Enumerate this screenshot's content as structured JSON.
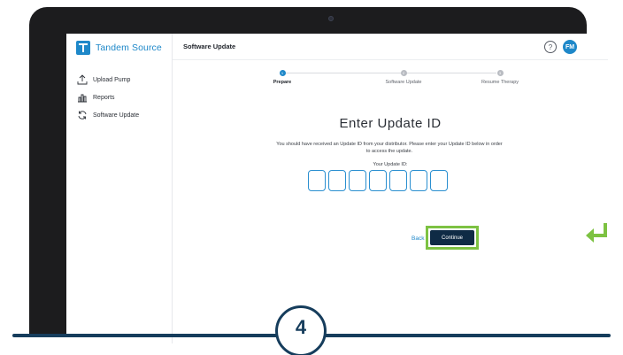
{
  "app": {
    "brand_name": "Tandem Source",
    "brand_color": "#1e88c9"
  },
  "sidebar": {
    "items": [
      {
        "label": "Upload Pump",
        "icon": "upload-icon"
      },
      {
        "label": "Reports",
        "icon": "bar-chart-icon"
      },
      {
        "label": "Software Update",
        "icon": "refresh-icon"
      }
    ]
  },
  "header": {
    "title": "Software Update",
    "help_glyph": "?",
    "avatar_initials": "FM"
  },
  "stepper": {
    "steps": [
      {
        "number": "1",
        "label": "Prepare",
        "active": true
      },
      {
        "number": "2",
        "label": "Software Update",
        "active": false
      },
      {
        "number": "3",
        "label": "Resume Therapy",
        "active": false
      }
    ]
  },
  "main": {
    "heading": "Enter Update ID",
    "description": "You should have received an Update ID from your distributor. Please enter your Update ID below in order to access the update.",
    "id_label": "Your Update ID:",
    "id_box_count": 7,
    "back_label": "Back",
    "continue_label": "Continue"
  },
  "overlay": {
    "step_number": "4",
    "highlight_color": "#7dc242",
    "accent_dark": "#163d5c",
    "return_icon": "return-arrow-icon"
  }
}
